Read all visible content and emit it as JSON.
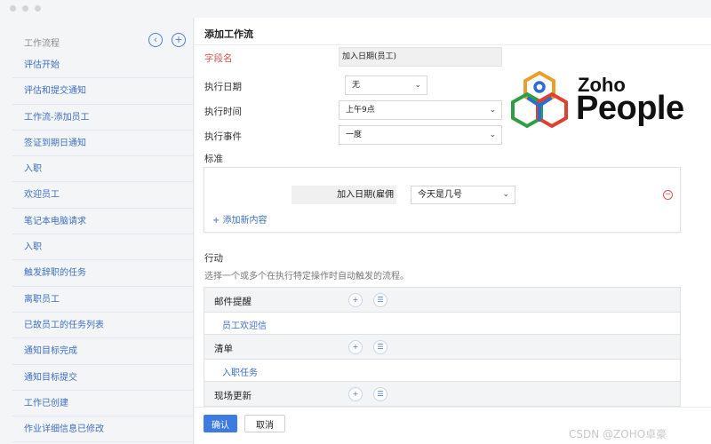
{
  "sidebar": {
    "title": "工作流程",
    "items": [
      {
        "label": "评估开始"
      },
      {
        "label": "评估和提交通知"
      },
      {
        "label": "工作流-添加员工"
      },
      {
        "label": "签证到期日通知"
      },
      {
        "label": "入职"
      },
      {
        "label": "欢迎员工"
      },
      {
        "label": "笔记本电脑请求"
      },
      {
        "label": "入职"
      },
      {
        "label": "触发辞职的任务"
      },
      {
        "label": "离职员工"
      },
      {
        "label": "已故员工的任务列表"
      },
      {
        "label": "通知目标完成"
      },
      {
        "label": "通知目标提交"
      },
      {
        "label": "工作已创建"
      },
      {
        "label": "作业详细信息已修改"
      }
    ]
  },
  "form": {
    "title": "添加工作流",
    "field_name_label": "字段名",
    "field_name_value": "加入日期(员工)",
    "exec_date_label": "执行日期",
    "exec_date_value": "无",
    "exec_time_label": "执行时间",
    "exec_time_value": "上午9点",
    "exec_event_label": "执行事件",
    "exec_event_value": "一度"
  },
  "criteria": {
    "label": "标准",
    "field": "加入日期(雇佣",
    "operator": "今天是几号",
    "add_new": "+ 添加新内容"
  },
  "actions": {
    "title": "行动",
    "description": "选择一个或多个在执行特定操作时自动触发的流程。",
    "groups": [
      {
        "label": "邮件提醒",
        "item": "员工欢迎信"
      },
      {
        "label": "清单",
        "item": "入职任务"
      },
      {
        "label": "现场更新",
        "item": ""
      }
    ]
  },
  "footer": {
    "confirm": "确认",
    "cancel": "取消"
  },
  "logo": {
    "zoho": "Zoho",
    "people": "People"
  },
  "watermark": "CSDN @ZOHO卓豪",
  "colors": {
    "link": "#3d6fbf",
    "required": "#d9534f",
    "primary_button": "#3d7be0"
  }
}
